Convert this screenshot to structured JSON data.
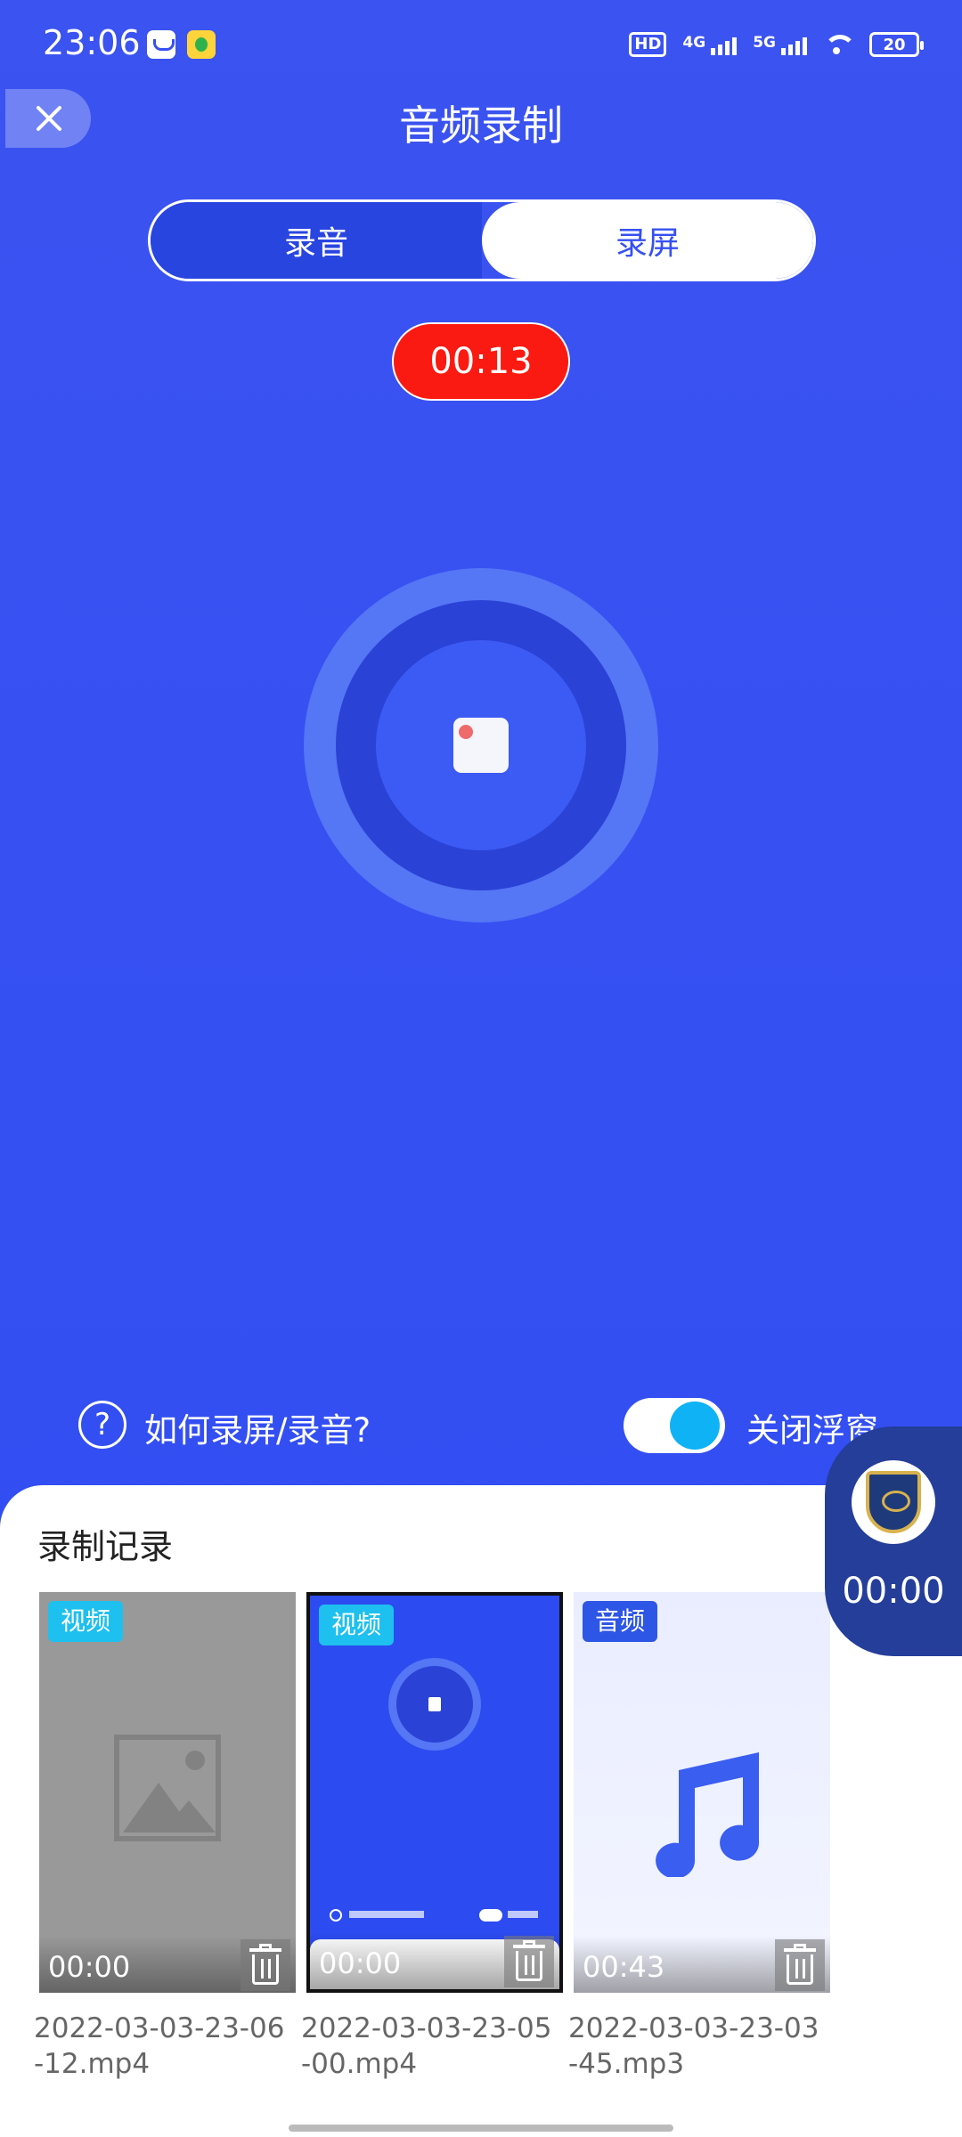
{
  "status_bar": {
    "time": "23:06",
    "hd_label": "HD",
    "signal_1_label": "4G",
    "signal_2_label": "5G",
    "battery": "20"
  },
  "header": {
    "title": "音频录制"
  },
  "tabs": [
    {
      "label": "录音",
      "active": true
    },
    {
      "label": "录屏",
      "active": false
    }
  ],
  "timer": "00:13",
  "help": {
    "icon": "?",
    "text": "如何录屏/录音?"
  },
  "float_toggle": {
    "label": "关闭浮窗",
    "on": true
  },
  "records": {
    "title": "录制记录",
    "items": [
      {
        "type": "视频",
        "duration": "00:00",
        "filename": "2022-03-03-23-06-12.mp4",
        "thumb": "placeholder-image-icon"
      },
      {
        "type": "视频",
        "duration": "00:00",
        "filename": "2022-03-03-23-05-00.mp4",
        "thumb": "screen-preview"
      },
      {
        "type": "音频",
        "duration": "00:43",
        "filename": "2022-03-03-23-03-45.mp3",
        "thumb": "music-note-icon"
      }
    ]
  },
  "floating_window": {
    "time": "00:00"
  },
  "colors": {
    "background": "#3650f2",
    "timer_badge": "#fb1a11",
    "toggle_knob": "#0fb2f5",
    "video_badge": "#1ec0ef",
    "audio_badge": "#2e56e6"
  }
}
